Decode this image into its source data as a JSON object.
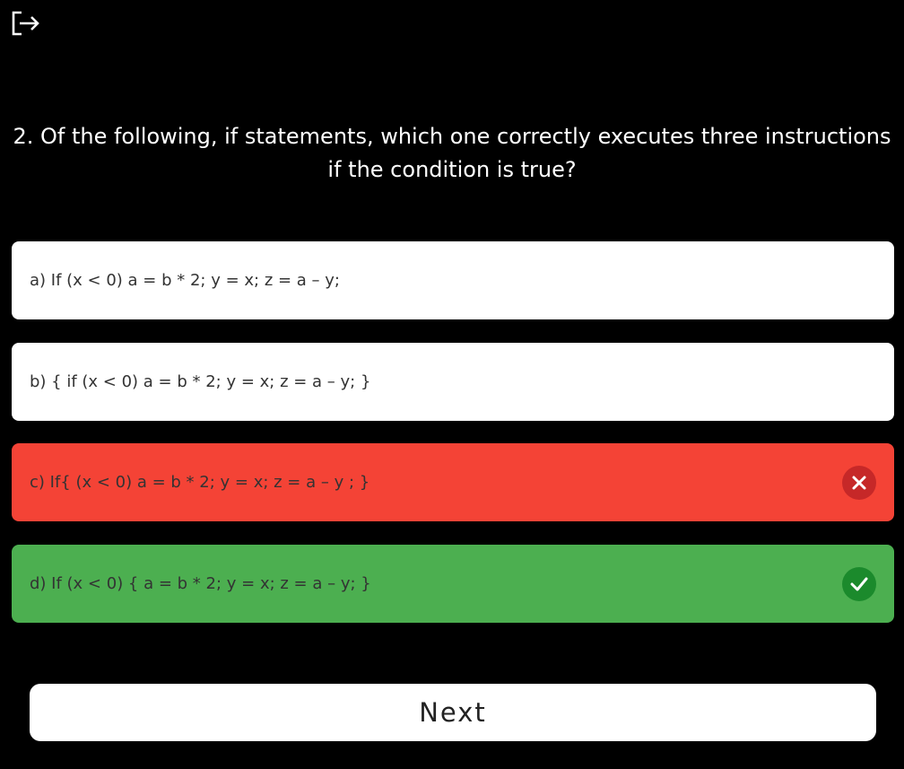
{
  "header": {
    "exit_icon": "logout-icon"
  },
  "question": {
    "text": "2. Of the following, if statements, which one correctly executes three instructions if the condition is true?"
  },
  "answers": [
    {
      "label": "a) If (x < 0) a = b * 2; y = x; z = a – y;",
      "state": "neutral",
      "background": "#ffffff"
    },
    {
      "label": "b) { if (x < 0) a = b * 2; y = x; z = a – y; }",
      "state": "neutral",
      "background": "#ffffff"
    },
    {
      "label": "c) If{ (x < 0) a = b * 2; y = x; z = a – y ; }",
      "state": "wrong",
      "background": "#f44336",
      "icon": "close-icon"
    },
    {
      "label": "d) If (x < 0) { a = b * 2; y = x; z = a – y; }",
      "state": "correct",
      "background": "#4caf50",
      "icon": "check-icon"
    }
  ],
  "footer": {
    "next_label": "Next"
  },
  "colors": {
    "background": "#000000",
    "wrong": "#f44336",
    "correct": "#4caf50"
  }
}
